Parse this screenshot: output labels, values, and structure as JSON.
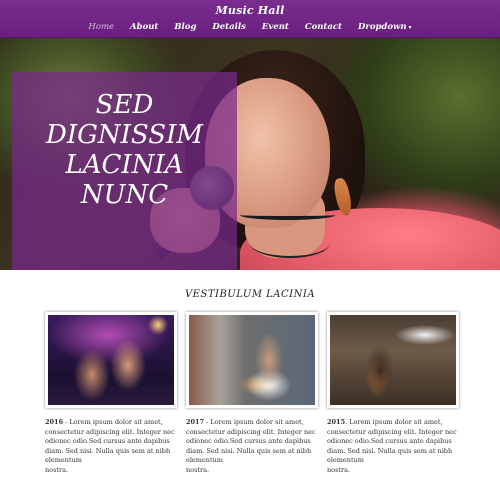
{
  "site": {
    "title": "Music Hall"
  },
  "nav": [
    {
      "label": "Home",
      "active": true
    },
    {
      "label": "About"
    },
    {
      "label": "Blog"
    },
    {
      "label": "Details"
    },
    {
      "label": "Event"
    },
    {
      "label": "Contact"
    },
    {
      "label": "Dropdown",
      "has_caret": true
    }
  ],
  "hero": {
    "lines": [
      "SED",
      "DIGNISSIM",
      "LACINIA",
      "NUNC"
    ]
  },
  "section": {
    "title": "VESTIBULUM LACINIA"
  },
  "cards": [
    {
      "year": "2016",
      "text": " - Lorem ipsum dolor sit amet, consectetur adipiscing elit. Integer nec odionec odio.Sed cursus ante dapibus diam. Sed nisi. Nulla quis sem at nibh elementum",
      "tail": "nostra."
    },
    {
      "year": "2017",
      "text": " - Lorem ipsum dolor sit amet, consectetur adipiscing elit. Integer nec odionec odio.Sed cursus ante dapibus diam. Sed nisi. Nulla quis sem at nibh elementum",
      "tail": "nostra."
    },
    {
      "year": "2015",
      "text": ". Lorem ipsum dolor sit amet, consectetur adipiscing elit. Integer nec odionec odio.Sed cursus ante dapibus diam. Sed nisi. Nulla quis sem at nibh elementum",
      "tail": "nostra."
    }
  ],
  "colors": {
    "header": "#6a1f7f",
    "overlay": "#782c8c",
    "active_nav": "#d9b8e6"
  }
}
